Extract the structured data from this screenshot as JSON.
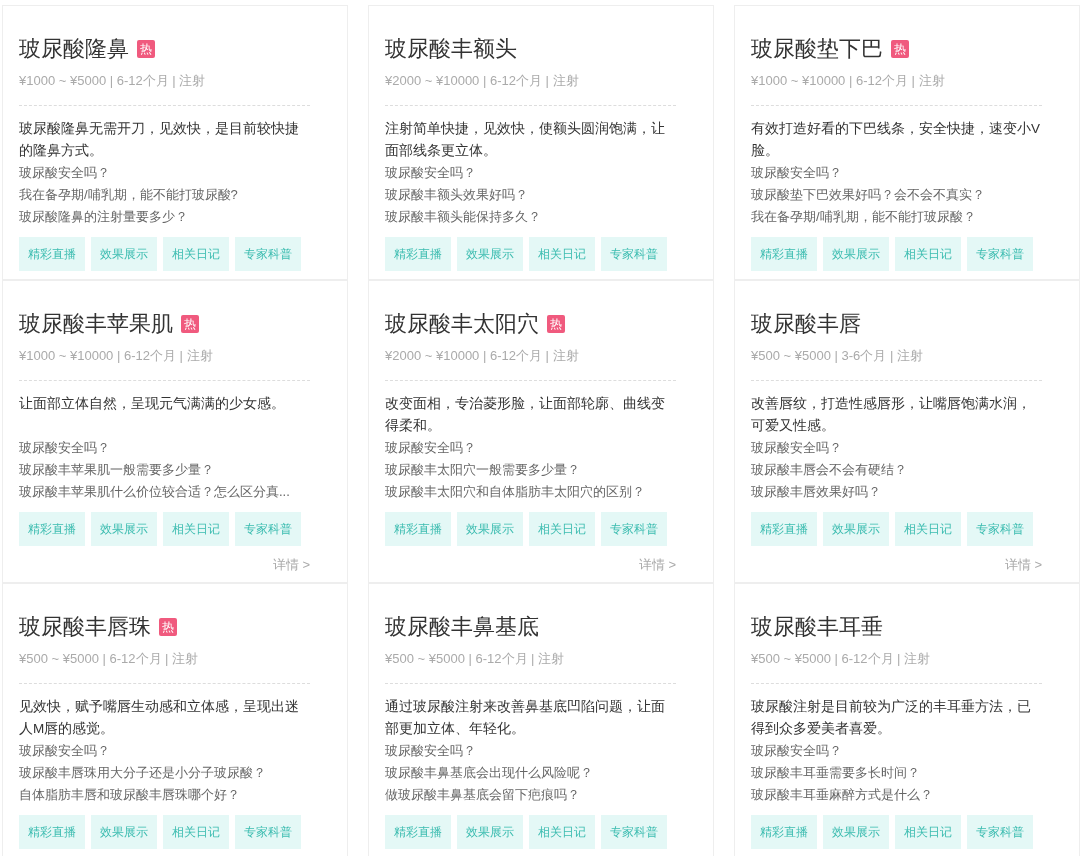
{
  "cards": [
    {
      "title": "玻尿酸隆鼻",
      "badge": "热",
      "meta": "¥1000 ~ ¥5000 | 6-12个月 | 注射",
      "description": "玻尿酸隆鼻无需开刀，见效快，是目前较快捷的隆鼻方式。",
      "questions": [
        "玻尿酸安全吗？",
        "我在备孕期/哺乳期，能不能打玻尿酸?",
        "玻尿酸隆鼻的注射量要多少？"
      ],
      "tags": [
        "精彩直播",
        "效果展示",
        "相关日记",
        "专家科普"
      ]
    },
    {
      "title": "玻尿酸丰额头",
      "meta": "¥2000 ~ ¥10000 | 6-12个月 | 注射",
      "description": "注射简单快捷，见效快，使额头圆润饱满，让面部线条更立体。",
      "questions": [
        "玻尿酸安全吗？",
        "玻尿酸丰额头效果好吗？",
        "玻尿酸丰额头能保持多久？"
      ],
      "tags": [
        "精彩直播",
        "效果展示",
        "相关日记",
        "专家科普"
      ]
    },
    {
      "title": "玻尿酸垫下巴",
      "badge": "热",
      "meta": "¥1000 ~ ¥10000 | 6-12个月 | 注射",
      "description": "有效打造好看的下巴线条，安全快捷，速变小V脸。",
      "questions": [
        "玻尿酸安全吗？",
        "玻尿酸垫下巴效果好吗？会不会不真实？",
        "我在备孕期/哺乳期，能不能打玻尿酸？"
      ],
      "tags": [
        "精彩直播",
        "效果展示",
        "相关日记",
        "专家科普"
      ]
    },
    {
      "title": "玻尿酸丰苹果肌",
      "badge": "热",
      "meta": "¥1000 ~ ¥10000 | 6-12个月 | 注射",
      "description": "让面部立体自然，呈现元气满满的少女感。",
      "questions": [
        "玻尿酸安全吗？",
        "玻尿酸丰苹果肌一般需要多少量？",
        "玻尿酸丰苹果肌什么价位较合适？怎么区分真..."
      ],
      "tags": [
        "精彩直播",
        "效果展示",
        "相关日记",
        "专家科普"
      ],
      "detail_link": "详情 >"
    },
    {
      "title": "玻尿酸丰太阳穴",
      "badge": "热",
      "meta": "¥2000 ~ ¥10000 | 6-12个月 | 注射",
      "description": "改变面相，专治菱形脸，让面部轮廓、曲线变得柔和。",
      "questions": [
        "玻尿酸安全吗？",
        "玻尿酸丰太阳穴一般需要多少量？",
        "玻尿酸丰太阳穴和自体脂肪丰太阳穴的区别？"
      ],
      "tags": [
        "精彩直播",
        "效果展示",
        "相关日记",
        "专家科普"
      ],
      "detail_link": "详情 >"
    },
    {
      "title": "玻尿酸丰唇",
      "meta": "¥500 ~ ¥5000 | 3-6个月 | 注射",
      "description": "改善唇纹，打造性感唇形，让嘴唇饱满水润，可爱又性感。",
      "questions": [
        "玻尿酸安全吗？",
        "玻尿酸丰唇会不会有硬结？",
        "玻尿酸丰唇效果好吗？"
      ],
      "tags": [
        "精彩直播",
        "效果展示",
        "相关日记",
        "专家科普"
      ],
      "detail_link": "详情 >"
    },
    {
      "title": "玻尿酸丰唇珠",
      "badge": "热",
      "meta": "¥500 ~ ¥5000 | 6-12个月 | 注射",
      "description": "见效快，赋予嘴唇生动感和立体感，呈现出迷人M唇的感觉。",
      "questions": [
        "玻尿酸安全吗？",
        "玻尿酸丰唇珠用大分子还是小分子玻尿酸？",
        "自体脂肪丰唇和玻尿酸丰唇珠哪个好？"
      ],
      "tags": [
        "精彩直播",
        "效果展示",
        "相关日记",
        "专家科普"
      ]
    },
    {
      "title": "玻尿酸丰鼻基底",
      "meta": "¥500 ~ ¥5000 | 6-12个月 | 注射",
      "description": "通过玻尿酸注射来改善鼻基底凹陷问题，让面部更加立体、年轻化。",
      "questions": [
        "玻尿酸安全吗？",
        "玻尿酸丰鼻基底会出现什么风险呢？",
        "做玻尿酸丰鼻基底会留下疤痕吗？"
      ],
      "tags": [
        "精彩直播",
        "效果展示",
        "相关日记",
        "专家科普"
      ]
    },
    {
      "title": "玻尿酸丰耳垂",
      "meta": "¥500 ~ ¥5000 | 6-12个月 | 注射",
      "description": "玻尿酸注射是目前较为广泛的丰耳垂方法，已得到众多爱美者喜爱。",
      "questions": [
        "玻尿酸安全吗？",
        "玻尿酸丰耳垂需要多长时间？",
        "玻尿酸丰耳垂麻醉方式是什么？"
      ],
      "tags": [
        "精彩直播",
        "效果展示",
        "相关日记",
        "专家科普"
      ]
    }
  ]
}
